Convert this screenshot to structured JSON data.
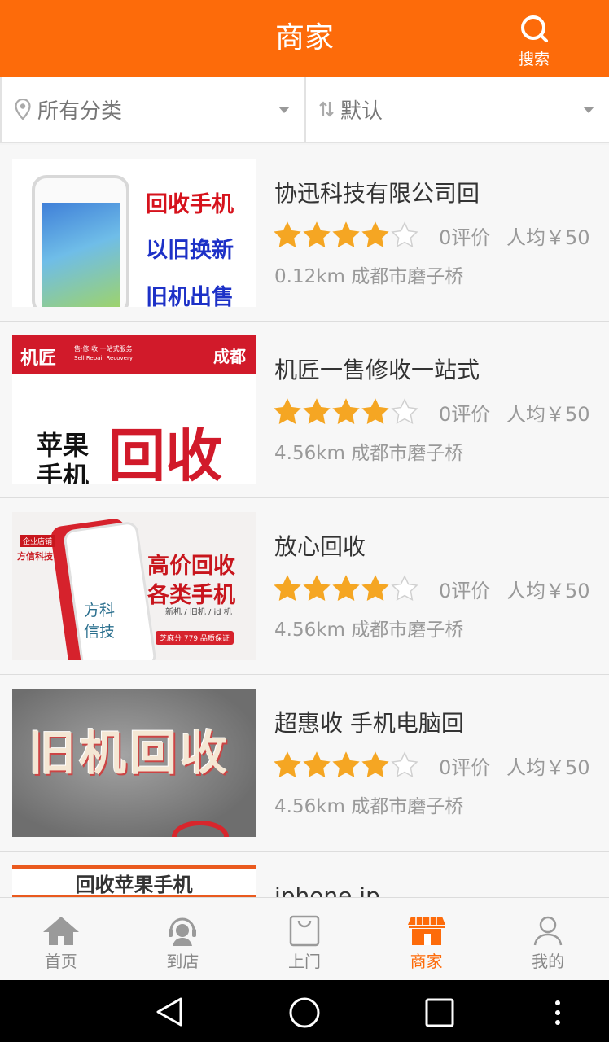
{
  "header": {
    "title": "商家",
    "search_label": "搜索"
  },
  "filters": {
    "category": "所有分类",
    "sort": "默认"
  },
  "stores": [
    {
      "name": "协迅科技有限公司回",
      "rating": 4,
      "reviews": "0评价",
      "price": "人均￥50",
      "location": "0.12km 成都市磨子桥",
      "thumb_text": [
        "回收手机",
        "以旧换新",
        "旧机出售"
      ]
    },
    {
      "name": "机匠一售修收一站式",
      "rating": 4,
      "reviews": "0评价",
      "price": "人均￥50",
      "location": "4.56km 成都市磨子桥",
      "thumb_text": [
        "机匠",
        "售·修·收 一站式服务",
        "Sell Repair Recovery",
        "成都",
        "苹果",
        "手机",
        "回收"
      ]
    },
    {
      "name": "放心回收",
      "rating": 4,
      "reviews": "0评价",
      "price": "人均￥50",
      "location": "4.56km 成都市磨子桥",
      "thumb_text": [
        "企业店铺",
        "方信科技",
        "高价回收",
        "各类手机",
        "新机 / 旧机 / id 机",
        "芝麻分 779 品质保证",
        "方科",
        "信技"
      ]
    },
    {
      "name": "超惠收 手机电脑回",
      "rating": 4,
      "reviews": "0评价",
      "price": "人均￥50",
      "location": "4.56km 成都市磨子桥",
      "thumb_text": [
        "旧机回收"
      ]
    },
    {
      "name": "iphone.ip",
      "thumb_text": [
        "回收苹果手机"
      ]
    }
  ],
  "tabs": [
    {
      "label": "首页",
      "icon": "home-icon"
    },
    {
      "label": "到店",
      "icon": "service-icon"
    },
    {
      "label": "上门",
      "icon": "bag-icon"
    },
    {
      "label": "商家",
      "icon": "shop-icon",
      "active": true
    },
    {
      "label": "我的",
      "icon": "user-icon"
    }
  ],
  "colors": {
    "accent": "#fd6b0a",
    "star": "#f5a623",
    "star_empty": "#e0e0e0"
  }
}
